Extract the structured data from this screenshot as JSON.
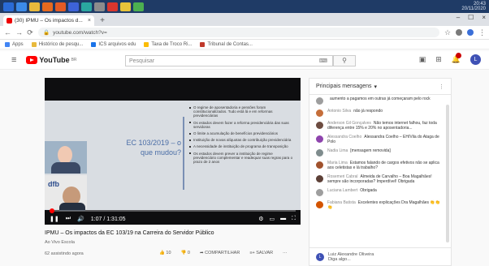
{
  "taskbar": {
    "apps": [
      {
        "name": "start-icon",
        "color": "#2a6bd6"
      },
      {
        "name": "ie-icon",
        "color": "#3c8be8"
      },
      {
        "name": "folder-icon",
        "color": "#e8b93c"
      },
      {
        "name": "media-player-icon",
        "color": "#e66a1f"
      },
      {
        "name": "firefox-icon",
        "color": "#e35b25"
      },
      {
        "name": "app-icon-blue",
        "color": "#3d63d8"
      },
      {
        "name": "app-icon-teal",
        "color": "#2aa7a0"
      },
      {
        "name": "app-icon-gray",
        "color": "#8c8c8c"
      },
      {
        "name": "app-icon-red",
        "color": "#d9362e"
      },
      {
        "name": "app-icon-yellow",
        "color": "#e8c43a"
      },
      {
        "name": "chrome-icon",
        "color": "#4caf50"
      }
    ],
    "clock_time": "20:43",
    "clock_date": "20/11/2020"
  },
  "browser": {
    "tab_title": "(30) IPMU – Os impactos d...",
    "url": "youtube.com/watch?v=",
    "bookmarks": [
      "Apps",
      "Histórico de pesqu...",
      "ICS arquivos edu",
      "Taxa de Troco Ri...",
      "Tribunal de Contas..."
    ]
  },
  "youtube": {
    "logo_text": "YouTube",
    "logo_country": "BR",
    "search_placeholder": "Pesquisar"
  },
  "video": {
    "slide_title": "EC 103/2019 – o que mudou?",
    "bullets": [
      "O regime de aposentadoria e pensões foram constitucionalizados. Tudo está lá e em reformas previdenciárias",
      "Os estados devem fazer a reforma previdenciária das suas servidoras",
      "O limite a acumulação de benefícios previdenciários",
      "Instituição de novas alíquotas de contribuição previdenciária",
      "A necessidade de instituição de programa de transposição",
      "Os estados devem prever a instituição de regime previdenciário complementar e readequar suas regras para o prazo de 2 anos"
    ],
    "time": "1:07 / 1:31:05",
    "progress": 0.01,
    "title": "IPMU – Os impactos da EC 103/19 na Carreira do Servidor Público",
    "subtitle": "Ao Vivo Escola",
    "meta": "62 assistindo agora",
    "likes": "10",
    "dislikes": "0",
    "share": "COMPARTILHAR",
    "save": "SALVAR"
  },
  "chat": {
    "header": "Principais mensagens",
    "messages": [
      {
        "author": "",
        "text": "aumento a pagamos em outras já começaram pelo rock",
        "color": "#9e9e9e"
      },
      {
        "author": "Antonio Silva",
        "text": "não já respondo",
        "color": "#c56e3a"
      },
      {
        "author": "Anderson Gil Gonçalves",
        "text": "Não temos internet falhou, faz toda diferença entre 15% e 20% no aposentadoria...",
        "color": "#6d4c41"
      },
      {
        "author": "Alessandra Coelho",
        "text": "Alessandra Coelho – EH/Vila do Ataga de Polo",
        "color": "#8e44ad"
      },
      {
        "author": "Nadia Lima",
        "text": "[mensagem removida]",
        "color": "#7f8c8d"
      },
      {
        "author": "Maria Lima",
        "text": "Estamos falando de cargos efetivos não se aplica aos celetistas e lá trabalho?",
        "color": "#a0522d"
      },
      {
        "author": "Rosemeri Cabral",
        "text": "Almeida de Carvalho – Boa Magalhães! sempre são incorporadas? Imperdível! Obrigada",
        "color": "#5d4037"
      },
      {
        "author": "Luciana Lambert",
        "text": "Obrigada",
        "color": "#9e9e9e"
      },
      {
        "author": "Fabiana Batista",
        "text": "Excelentes explicações Dra Magalhães 👏👏👏",
        "color": "#d35400"
      }
    ],
    "input_user": "Luiz Alexandre Oliveira",
    "input_placeholder": "Diga algo..."
  }
}
